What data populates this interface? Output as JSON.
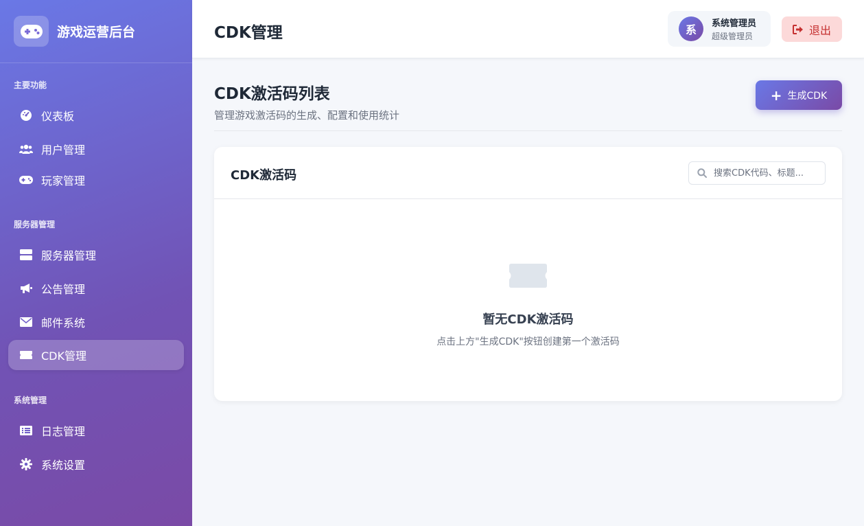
{
  "sidebar": {
    "brand_title": "游戏运营后台",
    "sections": [
      {
        "label": "主要功能"
      },
      {
        "label": "服务器管理"
      },
      {
        "label": "系统管理"
      }
    ],
    "items": [
      {
        "label": "仪表板",
        "icon": "dashboard-icon"
      },
      {
        "label": "用户管理",
        "icon": "users-icon"
      },
      {
        "label": "玩家管理",
        "icon": "gamepad-icon"
      },
      {
        "label": "服务器管理",
        "icon": "server-icon"
      },
      {
        "label": "公告管理",
        "icon": "megaphone-icon"
      },
      {
        "label": "邮件系统",
        "icon": "mail-icon"
      },
      {
        "label": "CDK管理",
        "icon": "ticket-icon",
        "active": true
      },
      {
        "label": "日志管理",
        "icon": "list-icon"
      },
      {
        "label": "系统设置",
        "icon": "gear-icon"
      }
    ]
  },
  "header": {
    "title": "CDK管理",
    "user": {
      "avatar_text": "系",
      "name": "系统管理员",
      "role": "超级管理员"
    },
    "logout_label": "退出"
  },
  "main": {
    "title": "CDK激活码列表",
    "subtitle": "管理游戏激活码的生成、配置和使用统计",
    "generate_label": "生成CDK",
    "card": {
      "title": "CDK激活码",
      "search_placeholder": "搜索CDK代码、标题...",
      "empty_title": "暂无CDK激活码",
      "empty_desc": "点击上方\"生成CDK\"按钮创建第一个激活码"
    }
  },
  "colors": {
    "accent_start": "#6a78e6",
    "accent_end": "#7a4aa6",
    "logout_bg": "#fcd9d9",
    "logout_text": "#c53030"
  }
}
